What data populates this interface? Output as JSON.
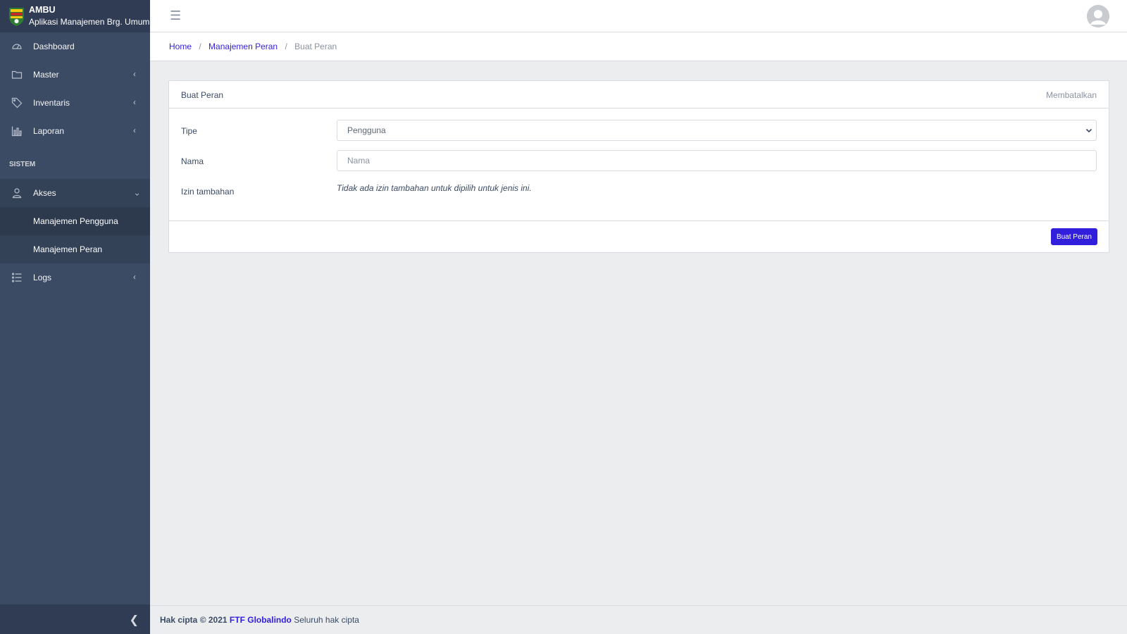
{
  "app": {
    "title": "AMBU",
    "subtitle": "Aplikasi Manajemen Brg. Umum"
  },
  "sidebar": {
    "items": [
      {
        "label": "Dashboard",
        "icon": "speedometer-icon"
      },
      {
        "label": "Master",
        "icon": "folder-icon"
      },
      {
        "label": "Inventaris",
        "icon": "tag-icon"
      },
      {
        "label": "Laporan",
        "icon": "bar-chart-icon"
      }
    ],
    "section_title": "SISTEM",
    "group": {
      "label": "Akses",
      "icon": "user-icon",
      "children": [
        "Manajemen Pengguna",
        "Manajemen Peran"
      ]
    },
    "logs_label": "Logs"
  },
  "breadcrumb": {
    "home": "Home",
    "parent": "Manajemen Peran",
    "current": "Buat Peran",
    "separator": "/"
  },
  "card": {
    "title": "Buat Peran",
    "cancel_label": "Membatalkan",
    "fields": {
      "type_label": "Tipe",
      "type_value": "Pengguna",
      "name_label": "Nama",
      "name_placeholder": "Nama",
      "perm_label": "Izin tambahan",
      "perm_note": "Tidak ada izin tambahan untuk dipilih untuk jenis ini."
    },
    "submit_label": "Buat Peran"
  },
  "footer": {
    "prefix": "Hak cipta © 2021",
    "company": "FTF Globalindo",
    "suffix": "Seluruh hak cipta"
  },
  "colors": {
    "sidebar": "#3c4b64",
    "primary": "#321fdb",
    "background": "#ebedef"
  }
}
